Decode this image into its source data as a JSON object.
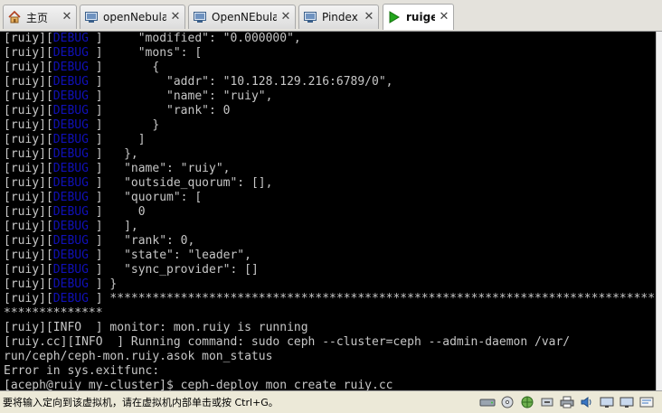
{
  "tabs": [
    {
      "label": "主页",
      "icon": "home-icon",
      "active": false
    },
    {
      "label": "openNebula",
      "icon": "vm-icon",
      "active": false
    },
    {
      "label": "OpenNEbula",
      "icon": "vm-icon",
      "active": false
    },
    {
      "label": "Pindex",
      "icon": "vm-icon",
      "active": false
    },
    {
      "label": "ruige",
      "icon": "vm-running-icon",
      "active": true
    }
  ],
  "terminal": {
    "lines": [
      "[ruiy][DEBUG ]     \"modified\": \"0.000000\",",
      "[ruiy][DEBUG ]     \"mons\": [",
      "[ruiy][DEBUG ]       {",
      "[ruiy][DEBUG ]         \"addr\": \"10.128.129.216:6789/0\",",
      "[ruiy][DEBUG ]         \"name\": \"ruiy\",",
      "[ruiy][DEBUG ]         \"rank\": 0",
      "[ruiy][DEBUG ]       }",
      "[ruiy][DEBUG ]     ]",
      "[ruiy][DEBUG ]   },",
      "[ruiy][DEBUG ]   \"name\": \"ruiy\",",
      "[ruiy][DEBUG ]   \"outside_quorum\": [],",
      "[ruiy][DEBUG ]   \"quorum\": [",
      "[ruiy][DEBUG ]     0",
      "[ruiy][DEBUG ]   ],",
      "[ruiy][DEBUG ]   \"rank\": 0,",
      "[ruiy][DEBUG ]   \"state\": \"leader\",",
      "[ruiy][DEBUG ]   \"sync_provider\": []",
      "[ruiy][DEBUG ] }",
      "[ruiy][DEBUG ] **********************************************************************************",
      "**************",
      "[ruiy][INFO  ] monitor: mon.ruiy is running",
      "[ruiy.cc][INFO  ] Running command: sudo ceph --cluster=ceph --admin-daemon /var/",
      "run/ceph/ceph-mon.ruiy.asok mon_status",
      "Error in sys.exitfunc:",
      "[aceph@ruiy my-cluster]$ ceph-deploy mon create ruiy.cc_"
    ]
  },
  "statusbar": {
    "message": "要将输入定向到该虚拟机，请在虚拟机内部单击或按 Ctrl+G。",
    "tray_icons": [
      "hard-disk-icon",
      "cd-rom-icon",
      "network-icon",
      "usb-icon",
      "printer-icon",
      "sound-icon",
      "display-icon",
      "display-icon",
      "message-icon"
    ]
  },
  "colors": {
    "debug_tag": "#1010b8",
    "terminal_text": "#c6c6c6",
    "terminal_bg": "#000000"
  }
}
